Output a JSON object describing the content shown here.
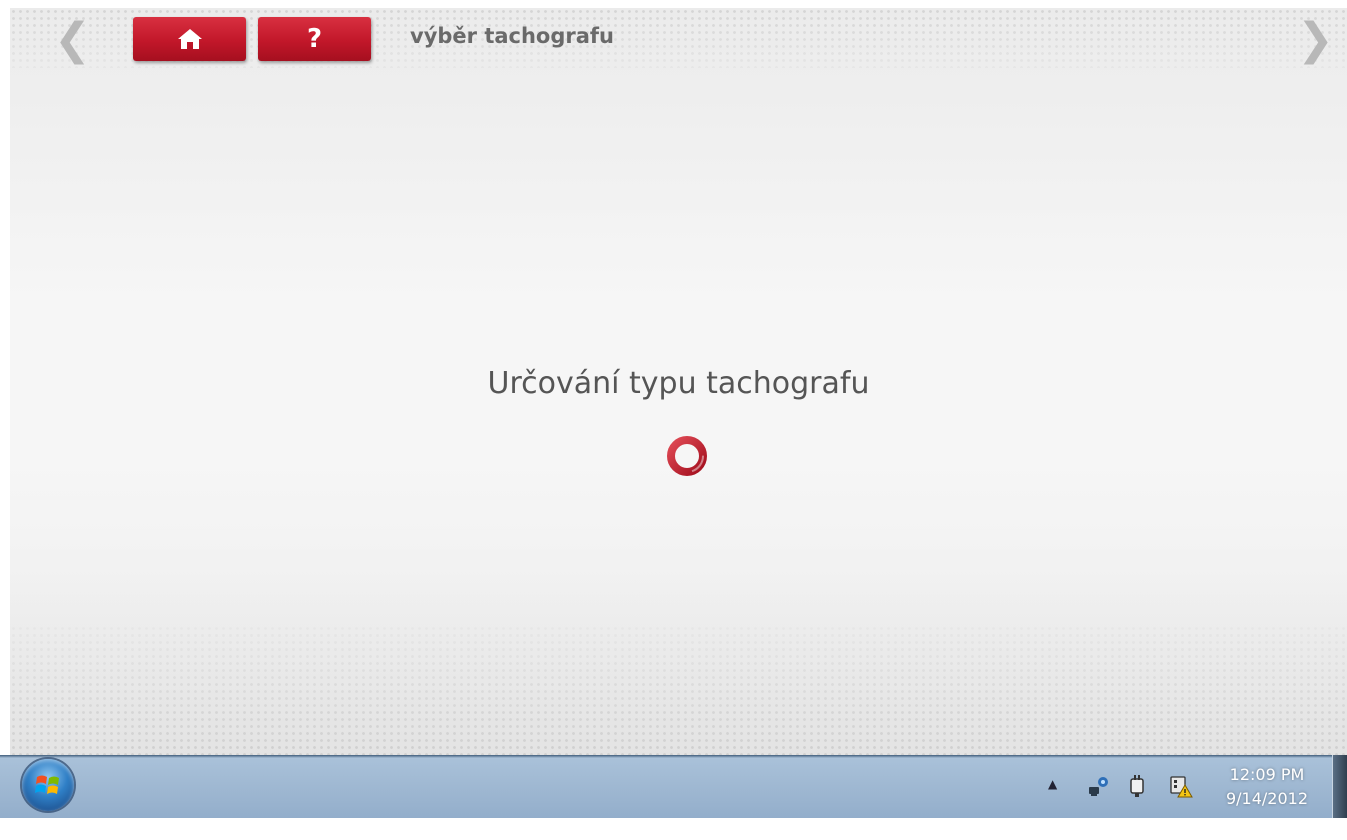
{
  "header": {
    "title": "výběr tachografu",
    "prev_arrow": "❮",
    "next_arrow": "❯",
    "home_icon": "home-icon",
    "help_label": "?"
  },
  "main": {
    "status_text": "Určování typu tachografu",
    "spinner_icon": "loading-spinner-icon"
  },
  "taskbar": {
    "tray_expand": "▲",
    "clock_time": "12:09 PM",
    "clock_date": "9/14/2012"
  },
  "colors": {
    "accent_red": "#c2172a",
    "title_gray": "#6a6a6a",
    "taskbar_blue": "#9fb8d2"
  }
}
